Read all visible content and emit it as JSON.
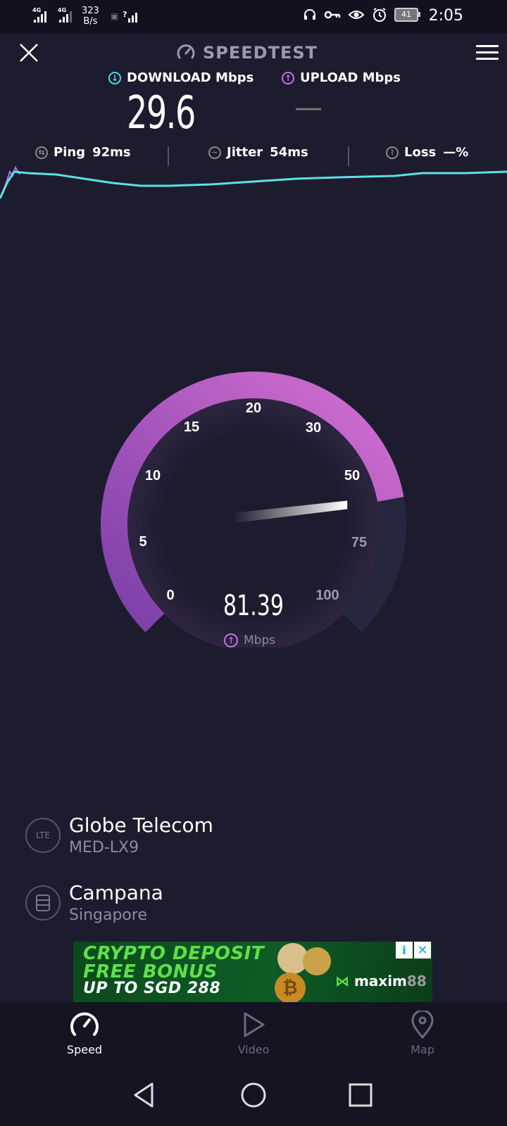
{
  "status_bar": {
    "net_speed_value": "323",
    "net_speed_unit": "B/s",
    "battery": "41",
    "time": "2:05",
    "signal_tags": [
      "4G",
      "4G"
    ],
    "icons": [
      "signal-icon",
      "signal-icon",
      "notification-icon",
      "wifi-question-icon",
      "headset-icon",
      "vpn-key-icon",
      "eye-icon",
      "alarm-icon",
      "battery-icon"
    ]
  },
  "header": {
    "title": "SPEEDTEST"
  },
  "download": {
    "label": "DOWNLOAD Mbps",
    "value": "29.6"
  },
  "upload": {
    "label": "UPLOAD Mbps",
    "value": "—"
  },
  "metrics": {
    "ping_label": "Ping",
    "ping_value": "92ms",
    "jitter_label": "Jitter",
    "jitter_value": "54ms",
    "loss_label": "Loss",
    "loss_value": "—%"
  },
  "gauge": {
    "ticks": [
      "0",
      "5",
      "10",
      "15",
      "20",
      "30",
      "50",
      "75",
      "100"
    ],
    "value": "81.39",
    "unit": "Mbps",
    "colors": {
      "start": "#7b3fa8",
      "end": "#d56fd2",
      "track": "#2a2a44"
    }
  },
  "provider": {
    "name": "Globe Telecom",
    "device": "MED-LX9",
    "icon_label": "LTE"
  },
  "server": {
    "name": "Campana",
    "location": "Singapore"
  },
  "ad": {
    "line1": "CRYPTO DEPOSIT",
    "line2": "FREE BONUS",
    "line3": "UP TO SGD 288",
    "brand": "maxim",
    "brand_num": "88",
    "info": "i",
    "close": "✕"
  },
  "nav": {
    "speed": "Speed",
    "video": "Video",
    "map": "Map"
  }
}
